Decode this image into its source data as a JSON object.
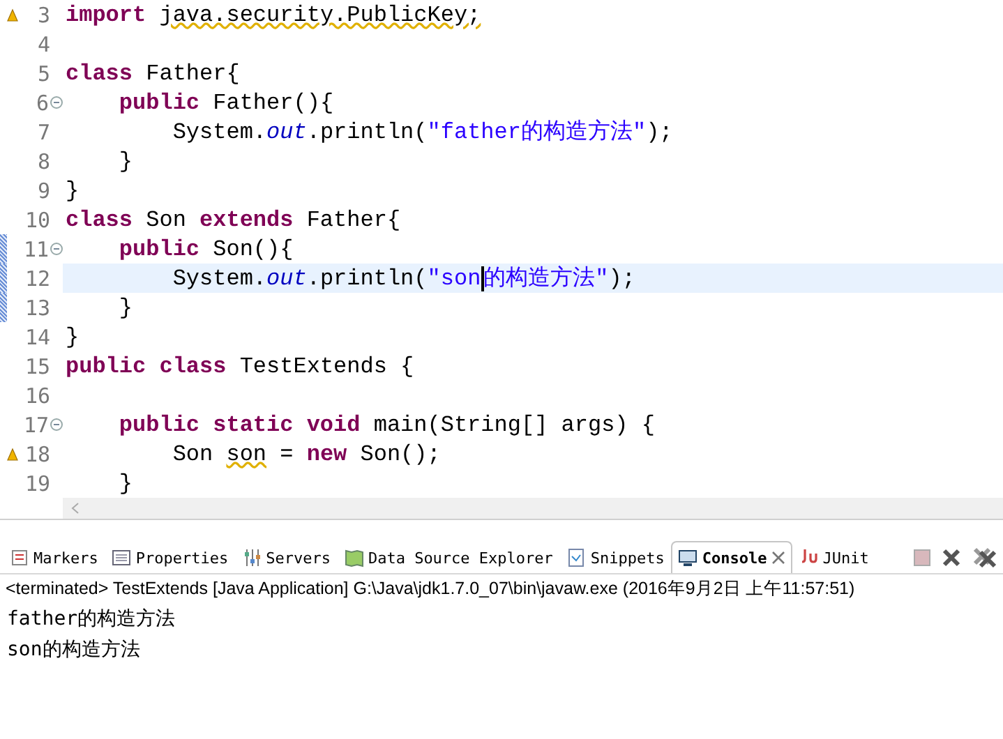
{
  "editor": {
    "lines": [
      {
        "number": "3",
        "warning": true,
        "foldable": false,
        "changed": false,
        "current": false,
        "tokens": [
          {
            "t": "import ",
            "keyword": true
          },
          {
            "t": "java.security.PublicKey;",
            "warn": true
          }
        ]
      },
      {
        "number": "4",
        "warning": false,
        "foldable": false,
        "changed": false,
        "current": false
      },
      {
        "number": "5",
        "warning": false,
        "foldable": false,
        "changed": false,
        "current": false,
        "tokens": [
          {
            "t": "class ",
            "keyword": true
          },
          {
            "t": "Father{"
          }
        ]
      },
      {
        "number": "6",
        "warning": false,
        "foldable": true,
        "changed": false,
        "current": false,
        "tokens": [
          {
            "t": "    public ",
            "keyword": true
          },
          {
            "t": "Father(){"
          }
        ]
      },
      {
        "number": "7",
        "warning": false,
        "foldable": false,
        "changed": false,
        "current": false,
        "tokens": [
          {
            "t": "        System."
          },
          {
            "t": "out",
            "field": true
          },
          {
            "t": ".println("
          },
          {
            "t": "\"father的构造方法\"",
            "string": true
          },
          {
            "t": ");"
          }
        ]
      },
      {
        "number": "8",
        "warning": false,
        "foldable": false,
        "changed": false,
        "current": false,
        "tokens": [
          {
            "t": "    }"
          }
        ]
      },
      {
        "number": "9",
        "warning": false,
        "foldable": false,
        "changed": false,
        "current": false,
        "tokens": [
          {
            "t": "}"
          }
        ]
      },
      {
        "number": "10",
        "warning": false,
        "foldable": false,
        "changed": false,
        "current": false,
        "tokens": [
          {
            "t": "class ",
            "keyword": true
          },
          {
            "t": "Son "
          },
          {
            "t": "extends ",
            "keyword": true
          },
          {
            "t": "Father{"
          }
        ]
      },
      {
        "number": "11",
        "warning": false,
        "foldable": true,
        "changed": true,
        "current": false,
        "tokens": [
          {
            "t": "    public ",
            "keyword": true
          },
          {
            "t": "Son(){"
          }
        ]
      },
      {
        "number": "12",
        "warning": false,
        "foldable": false,
        "changed": true,
        "current": true,
        "tokens": [
          {
            "t": "        System."
          },
          {
            "t": "out",
            "field": true
          },
          {
            "t": ".println("
          },
          {
            "t": "\"son",
            "string": true,
            "caret": true
          },
          {
            "t": "的构造方法\"",
            "string": true
          },
          {
            "t": ");"
          }
        ]
      },
      {
        "number": "13",
        "warning": false,
        "foldable": false,
        "changed": true,
        "current": false,
        "tokens": [
          {
            "t": "    }"
          }
        ]
      },
      {
        "number": "14",
        "warning": false,
        "foldable": false,
        "changed": false,
        "current": false,
        "tokens": [
          {
            "t": "}"
          }
        ]
      },
      {
        "number": "15",
        "warning": false,
        "foldable": false,
        "changed": false,
        "current": false,
        "tokens": [
          {
            "t": "public class ",
            "keyword": true
          },
          {
            "t": "TestExtends {"
          }
        ]
      },
      {
        "number": "16",
        "warning": false,
        "foldable": false,
        "changed": false,
        "current": false
      },
      {
        "number": "17",
        "warning": false,
        "foldable": true,
        "changed": false,
        "current": false,
        "tokens": [
          {
            "t": "    public static void ",
            "keyword": true
          },
          {
            "t": "main(String[] args) {"
          }
        ]
      },
      {
        "number": "18",
        "warning": true,
        "foldable": false,
        "changed": false,
        "current": false,
        "tokens": [
          {
            "t": "        Son "
          },
          {
            "t": "son",
            "warn": true
          },
          {
            "t": " = "
          },
          {
            "t": "new ",
            "keyword": true
          },
          {
            "t": "Son();"
          }
        ]
      },
      {
        "number": "19",
        "warning": false,
        "foldable": false,
        "changed": false,
        "current": false,
        "tokens": [
          {
            "t": "    }"
          }
        ]
      }
    ]
  },
  "console_view": {
    "tabs": [
      {
        "label": "Markers",
        "selected": false,
        "closable": false
      },
      {
        "label": "Properties",
        "selected": false,
        "closable": false
      },
      {
        "label": "Servers",
        "selected": false,
        "closable": false
      },
      {
        "label": "Data Source Explorer",
        "selected": false,
        "closable": false
      },
      {
        "label": "Snippets",
        "selected": false,
        "closable": false
      },
      {
        "label": "Console",
        "selected": true,
        "closable": true
      },
      {
        "label": "JUnit",
        "selected": false,
        "closable": false
      }
    ],
    "toolbar": [
      {
        "disabled": true
      },
      {
        "disabled": false
      },
      {
        "disabled": false
      }
    ],
    "process": "<terminated> TestExtends [Java Application] G:\\Java\\jdk1.7.0_07\\bin\\javaw.exe (2016年9月2日 上午11:57:51)",
    "output": [
      "father的构造方法",
      "son的构造方法"
    ]
  }
}
